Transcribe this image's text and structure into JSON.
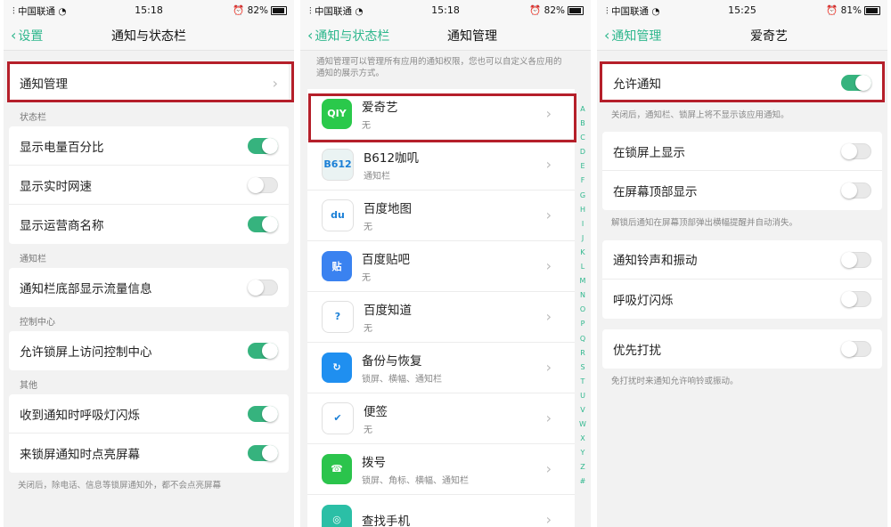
{
  "status": {
    "carrier": "中国联通",
    "screens": [
      {
        "time": "15:18",
        "battery": "82%"
      },
      {
        "time": "15:18",
        "battery": "82%"
      },
      {
        "time": "15:25",
        "battery": "81%"
      }
    ]
  },
  "screen1": {
    "back_label": "设置",
    "title": "通知与状态栏",
    "notify_manage": "通知管理",
    "section_statusbar": "状态栏",
    "show_battery_percent": "显示电量百分比",
    "show_net_speed": "显示实时网速",
    "show_carrier": "显示运营商名称",
    "section_notifybar": "通知栏",
    "show_traffic": "通知栏底部显示流量信息",
    "section_control": "控制中心",
    "lockscreen_control": "允许锁屏上访问控制中心",
    "section_other": "其他",
    "breath_light": "收到通知时呼吸灯闪烁",
    "wake_screen": "来锁屏通知时点亮屏幕",
    "footer_note": "关闭后，除电话、信息等锁屏通知外，都不会点亮屏幕"
  },
  "screen2": {
    "back_label": "通知与状态栏",
    "title": "通知管理",
    "description": "通知管理可以管理所有应用的通知权限，您也可以自定义各应用的通知的展示方式。",
    "apps": [
      {
        "name": "爱奇艺",
        "sub": "无",
        "icon": "iqiyi-icon",
        "icon_text": "QIY",
        "color": "#2ac94b"
      },
      {
        "name": "B612咖叽",
        "sub": "通知栏",
        "icon": "b612-icon",
        "icon_text": "B612",
        "color": "#eaf3f3"
      },
      {
        "name": "百度地图",
        "sub": "无",
        "icon": "baidu-map-icon",
        "icon_text": "du",
        "color": "#ffffff"
      },
      {
        "name": "百度贴吧",
        "sub": "无",
        "icon": "tieba-icon",
        "icon_text": "贴",
        "color": "#3a82f0"
      },
      {
        "name": "百度知道",
        "sub": "无",
        "icon": "zhidao-icon",
        "icon_text": "?",
        "color": "#ffffff"
      },
      {
        "name": "备份与恢复",
        "sub": "锁屏、横幅、通知栏",
        "icon": "backup-icon",
        "icon_text": "↻",
        "color": "#1f8ff0"
      },
      {
        "name": "便签",
        "sub": "无",
        "icon": "notes-icon",
        "icon_text": "✔",
        "color": "#ffffff"
      },
      {
        "name": "拨号",
        "sub": "锁屏、角标、横幅、通知栏",
        "icon": "phone-icon",
        "icon_text": "☎",
        "color": "#2bc44c"
      },
      {
        "name": "查找手机",
        "sub": "",
        "icon": "find-phone-icon",
        "icon_text": "◎",
        "color": "#2bbfa6"
      }
    ],
    "index_letters": [
      "A",
      "B",
      "C",
      "D",
      "E",
      "F",
      "G",
      "H",
      "I",
      "J",
      "K",
      "L",
      "M",
      "N",
      "O",
      "P",
      "Q",
      "R",
      "S",
      "T",
      "U",
      "V",
      "W",
      "X",
      "Y",
      "Z",
      "#"
    ]
  },
  "screen3": {
    "back_label": "通知管理",
    "title": "爱奇艺",
    "allow_notify": "允许通知",
    "allow_note": "关闭后，通知栏、锁屏上将不显示该应用通知。",
    "show_lockscreen": "在锁屏上显示",
    "show_top": "在屏幕顶部显示",
    "top_note": "解锁后通知在屏幕顶部弹出横幅提醒并自动消失。",
    "ringtone_vibrate": "通知铃声和振动",
    "breath_light": "呼吸灯闪烁",
    "priority": "优先打扰",
    "priority_note": "免打扰时来通知允许响铃或振动。"
  },
  "toggles": {
    "show_battery_percent": true,
    "show_net_speed": false,
    "show_carrier": true,
    "show_traffic": false,
    "lockscreen_control": true,
    "breath_light": true,
    "wake_screen": true,
    "allow_notify": true,
    "show_lockscreen": false,
    "show_top": false,
    "ringtone_vibrate": false,
    "app_breath_light": false,
    "priority": false
  },
  "colors": {
    "accent": "#36b37e",
    "highlight": "#b51f2a",
    "link": "#2fb78d"
  },
  "icons": {
    "back": "chevron-left-icon",
    "arrow": "chevron-right-icon"
  }
}
